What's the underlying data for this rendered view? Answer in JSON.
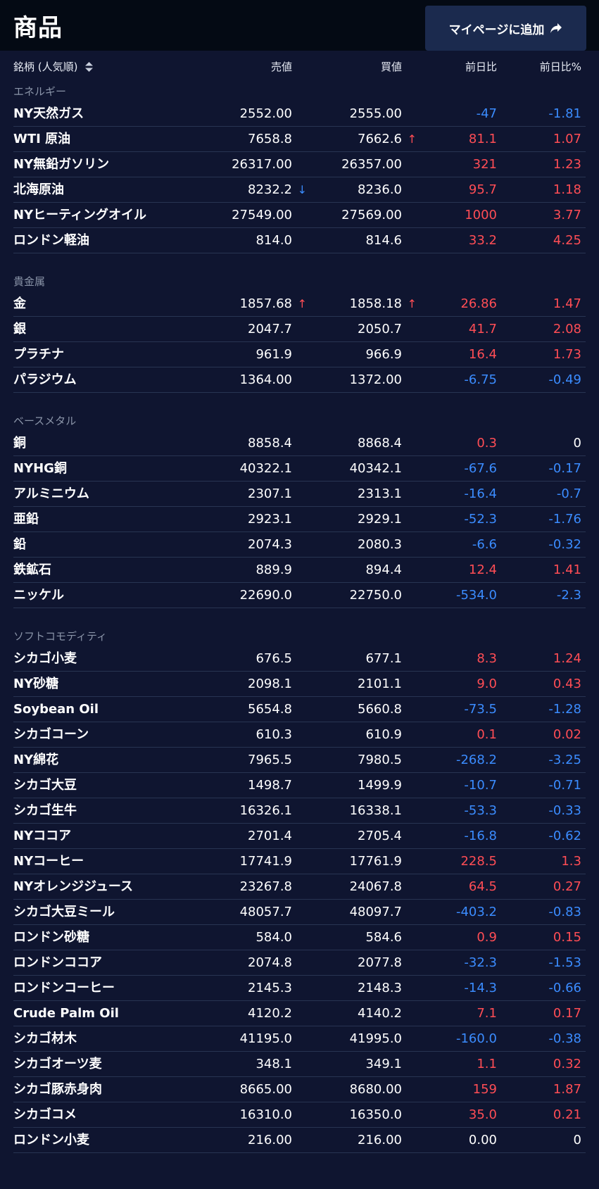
{
  "header": {
    "title": "商品",
    "mypage_button": "マイページに追加"
  },
  "columns": {
    "name": "銘柄 (人気順)",
    "sell": "売値",
    "buy": "買値",
    "change": "前日比",
    "change_pct": "前日比%"
  },
  "colors": {
    "up": "#ff4d55",
    "down": "#3b8cff",
    "background": "#0f1530"
  },
  "sections": [
    {
      "title": "エネルギー",
      "rows": [
        {
          "name": "NY天然ガス",
          "sell": "2552.00",
          "buy": "2555.00",
          "change": "-47",
          "pct": "-1.81"
        },
        {
          "name": "WTI 原油",
          "sell": "7658.8",
          "buy": "7662.6",
          "buy_arrow": "↑",
          "change": "81.1",
          "pct": "1.07"
        },
        {
          "name": "NY無鉛ガソリン",
          "sell": "26317.00",
          "buy": "26357.00",
          "change": "321",
          "pct": "1.23"
        },
        {
          "name": "北海原油",
          "sell": "8232.2",
          "sell_arrow": "↓",
          "buy": "8236.0",
          "change": "95.7",
          "pct": "1.18"
        },
        {
          "name": "NYヒーティングオイル",
          "sell": "27549.00",
          "buy": "27569.00",
          "change": "1000",
          "pct": "3.77"
        },
        {
          "name": "ロンドン軽油",
          "sell": "814.0",
          "buy": "814.6",
          "change": "33.2",
          "pct": "4.25"
        }
      ]
    },
    {
      "title": "貴金属",
      "rows": [
        {
          "name": "金",
          "sell": "1857.68",
          "sell_arrow": "↑",
          "buy": "1858.18",
          "buy_arrow": "↑",
          "change": "26.86",
          "pct": "1.47"
        },
        {
          "name": "銀",
          "sell": "2047.7",
          "buy": "2050.7",
          "change": "41.7",
          "pct": "2.08"
        },
        {
          "name": "プラチナ",
          "sell": "961.9",
          "buy": "966.9",
          "change": "16.4",
          "pct": "1.73"
        },
        {
          "name": "パラジウム",
          "sell": "1364.00",
          "buy": "1372.00",
          "change": "-6.75",
          "pct": "-0.49"
        }
      ]
    },
    {
      "title": "ベースメタル",
      "rows": [
        {
          "name": "銅",
          "sell": "8858.4",
          "buy": "8868.4",
          "change": "0.3",
          "pct": "0"
        },
        {
          "name": "NYHG銅",
          "sell": "40322.1",
          "buy": "40342.1",
          "change": "-67.6",
          "pct": "-0.17"
        },
        {
          "name": "アルミニウム",
          "sell": "2307.1",
          "buy": "2313.1",
          "change": "-16.4",
          "pct": "-0.7"
        },
        {
          "name": "亜鉛",
          "sell": "2923.1",
          "buy": "2929.1",
          "change": "-52.3",
          "pct": "-1.76"
        },
        {
          "name": "鉛",
          "sell": "2074.3",
          "buy": "2080.3",
          "change": "-6.6",
          "pct": "-0.32"
        },
        {
          "name": "鉄鉱石",
          "sell": "889.9",
          "buy": "894.4",
          "change": "12.4",
          "pct": "1.41"
        },
        {
          "name": "ニッケル",
          "sell": "22690.0",
          "buy": "22750.0",
          "change": "-534.0",
          "pct": "-2.3"
        }
      ]
    },
    {
      "title": "ソフトコモディティ",
      "rows": [
        {
          "name": "シカゴ小麦",
          "sell": "676.5",
          "buy": "677.1",
          "change": "8.3",
          "pct": "1.24"
        },
        {
          "name": "NY砂糖",
          "sell": "2098.1",
          "buy": "2101.1",
          "change": "9.0",
          "pct": "0.43"
        },
        {
          "name": "Soybean Oil",
          "sell": "5654.8",
          "buy": "5660.8",
          "change": "-73.5",
          "pct": "-1.28"
        },
        {
          "name": "シカゴコーン",
          "sell": "610.3",
          "buy": "610.9",
          "change": "0.1",
          "pct": "0.02"
        },
        {
          "name": "NY綿花",
          "sell": "7965.5",
          "buy": "7980.5",
          "change": "-268.2",
          "pct": "-3.25"
        },
        {
          "name": "シカゴ大豆",
          "sell": "1498.7",
          "buy": "1499.9",
          "change": "-10.7",
          "pct": "-0.71"
        },
        {
          "name": "シカゴ生牛",
          "sell": "16326.1",
          "buy": "16338.1",
          "change": "-53.3",
          "pct": "-0.33"
        },
        {
          "name": "NYココア",
          "sell": "2701.4",
          "buy": "2705.4",
          "change": "-16.8",
          "pct": "-0.62"
        },
        {
          "name": "NYコーヒー",
          "sell": "17741.9",
          "buy": "17761.9",
          "change": "228.5",
          "pct": "1.3"
        },
        {
          "name": "NYオレンジジュース",
          "sell": "23267.8",
          "buy": "24067.8",
          "change": "64.5",
          "pct": "0.27"
        },
        {
          "name": "シカゴ大豆ミール",
          "sell": "48057.7",
          "buy": "48097.7",
          "change": "-403.2",
          "pct": "-0.83"
        },
        {
          "name": "ロンドン砂糖",
          "sell": "584.0",
          "buy": "584.6",
          "change": "0.9",
          "pct": "0.15"
        },
        {
          "name": "ロンドンココア",
          "sell": "2074.8",
          "buy": "2077.8",
          "change": "-32.3",
          "pct": "-1.53"
        },
        {
          "name": "ロンドンコーヒー",
          "sell": "2145.3",
          "buy": "2148.3",
          "change": "-14.3",
          "pct": "-0.66"
        },
        {
          "name": "Crude Palm Oil",
          "sell": "4120.2",
          "buy": "4140.2",
          "change": "7.1",
          "pct": "0.17"
        },
        {
          "name": "シカゴ材木",
          "sell": "41195.0",
          "buy": "41995.0",
          "change": "-160.0",
          "pct": "-0.38"
        },
        {
          "name": "シカゴオーツ麦",
          "sell": "348.1",
          "buy": "349.1",
          "change": "1.1",
          "pct": "0.32"
        },
        {
          "name": "シカゴ豚赤身肉",
          "sell": "8665.00",
          "buy": "8680.00",
          "change": "159",
          "pct": "1.87"
        },
        {
          "name": "シカゴコメ",
          "sell": "16310.0",
          "buy": "16350.0",
          "change": "35.0",
          "pct": "0.21"
        },
        {
          "name": "ロンドン小麦",
          "sell": "216.00",
          "buy": "216.00",
          "change": "0.00",
          "pct": "0"
        }
      ]
    }
  ]
}
